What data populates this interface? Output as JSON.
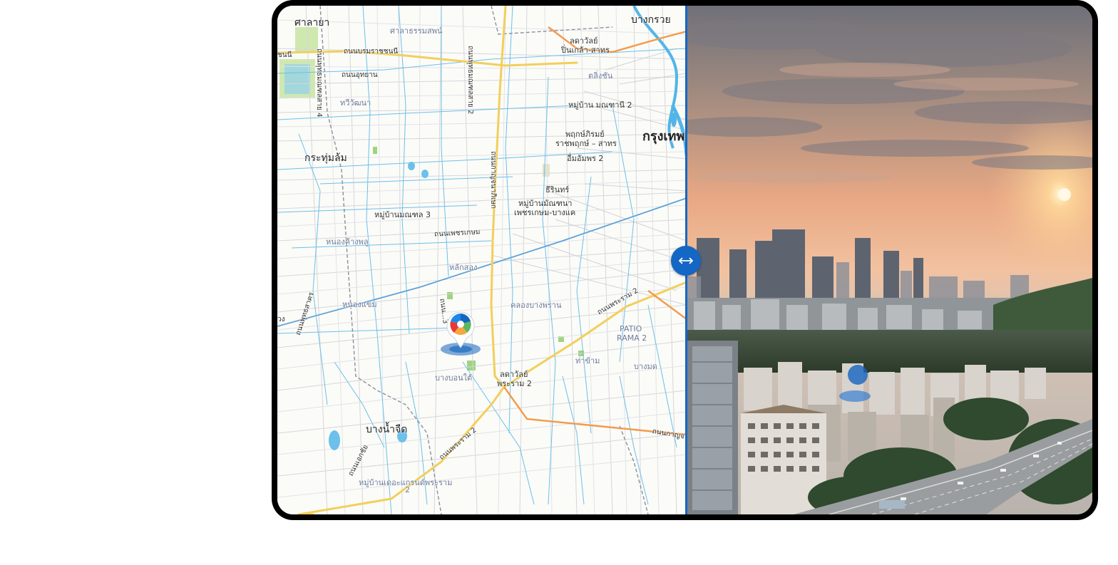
{
  "map": {
    "labels": {
      "salaya": "ศาลายา",
      "sala_thammasop": "ศาลาธรรมสพน์",
      "bang_kruai": "บางกรวย",
      "ladawan_pinklao_1": "ลดาวัลย์",
      "ladawan_pinklao_2": "ปิ่นเกล้า-สาทร",
      "khlong_chan": "ตลิ่งชัน",
      "road_borommaratchachonnani": "ถนนบรมราชชนนี",
      "road_uthayan": "ถนนอุทยาน",
      "thawi_watthana": "ทวีวัฒนา",
      "moo_ban_manthani": "หมู่บ้าน มณฑานี 2",
      "phruksa_1": "พฤกษ์ภิรมย์",
      "phruksa_2": "ราชพฤกษ์ – สาทร",
      "krungthep": "กรุงเทพ",
      "krathum_lom": "กระทุ่มล้ม",
      "ueam_amphon": "อื่มอัมพร 2",
      "thirin": "ธีรินทร์",
      "moo_ban_manthana_1": "หมู่บ้านมัณฑนา",
      "moo_ban_manthana_2": "เพชรเกษม-บางแค",
      "moo_ban_montol": "หมู่บ้านมณฑล 3",
      "road_phetkasem": "ถนนเพชรเกษม",
      "nong_khang_phlu": "หนองค้างพลู",
      "lak_song": "หลักสอง",
      "nong_khaem": "หนองแขม",
      "khlong_bang_phran": "คลองบางพราน",
      "road_rama2_upper": "ถนนพระราม 2",
      "patio_1": "PATIO",
      "patio_2": "RAMA 2",
      "tha_kham": "ท่าข้าม",
      "bang_mot": "บางมด",
      "bang_bon_tai": "บางบอนใต้",
      "ladawan_rama2_1": "ลดาวัลย์",
      "ladawan_rama2_2": "พระราม 2",
      "bang_nam_chuet": "บางน้ำจืด",
      "road_ekkachai": "ถนนเอกชัย",
      "road_rama2_lower": "ถนนพระราม 2",
      "moo_ban_grand_1": "หมู่บ้านเดอะแกรนด์พระราม",
      "moo_ban_grand_2": "2",
      "road_kanchana": "ถนนกาญจ",
      "road_phutthamonthon_4": "ถนนพุทธมณฑลสาย 4",
      "road_phutthamonthon_2": "ถนนพุทธมณฑลสาย 2",
      "road_kanchanaphisek": "ถนนกาญจนาภิเษก",
      "road_phet_ha": "ถนนเพชรหึงษ์",
      "road_side_left": "ถนนพุทธสาคร",
      "chon_left": "ชนนี",
      "wang_left": "วง",
      "road_soi3": "ถนน...3"
    }
  },
  "photo": {
    "description_alt": ""
  },
  "colors": {
    "accent": "#1467c4",
    "major_road": "#f2cf5b",
    "expressway": "#f39a4a",
    "water": "#5cb8e6"
  },
  "icons": {
    "handle": "left-right-arrow-icon",
    "pin": "location-pin-icon"
  }
}
